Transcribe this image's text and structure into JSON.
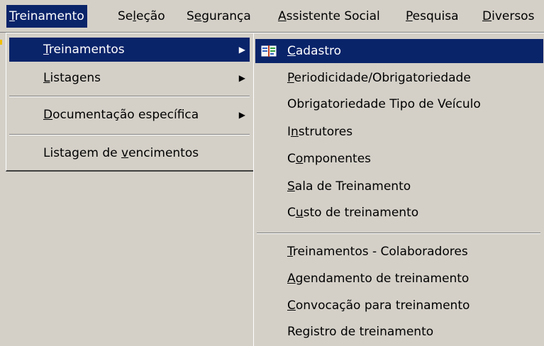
{
  "menubar": {
    "items": [
      {
        "id": "treinamento",
        "pre": "",
        "key": "T",
        "post": "reinamento",
        "active": true
      },
      {
        "id": "selecao",
        "pre": "Se",
        "key": "l",
        "post": "eção",
        "active": false
      },
      {
        "id": "seguranca",
        "pre": "S",
        "key": "e",
        "post": "gurança",
        "active": false
      },
      {
        "id": "assistente-social",
        "pre": "",
        "key": "A",
        "post": "ssistente Social",
        "active": false
      },
      {
        "id": "pesquisa",
        "pre": "",
        "key": "P",
        "post": "esquisa",
        "active": false
      },
      {
        "id": "diversos",
        "pre": "",
        "key": "D",
        "post": "iversos",
        "active": false
      }
    ]
  },
  "dropdown": {
    "items": [
      {
        "id": "treinamentos",
        "pre": "",
        "key": "T",
        "post": "reinamentos",
        "arrow": "▶",
        "selected": true
      },
      {
        "id": "listagens",
        "pre": "",
        "key": "L",
        "post": "istagens",
        "arrow": "▶",
        "selected": false
      },
      {
        "id": "documentacao-especifica",
        "pre": "",
        "key": "D",
        "post": "ocumentação específica",
        "arrow": "▶",
        "selected": false
      },
      {
        "id": "listagem-de-vencimentos",
        "pre": "Listagem de ",
        "key": "v",
        "post": "encimentos",
        "arrow": "",
        "selected": false
      }
    ]
  },
  "submenu": {
    "items": [
      {
        "id": "cadastro",
        "pre": "",
        "key": "C",
        "post": "adastro",
        "icon": "book-icon",
        "selected": true
      },
      {
        "id": "periodicidade",
        "pre": "",
        "key": "P",
        "post": "eriodicidade/Obrigatoriedade",
        "selected": false
      },
      {
        "id": "obrigatoriedade-tipo-veiculo",
        "pre": "Obrigatoriedade Tipo de Veículo",
        "key": "",
        "post": "",
        "selected": false
      },
      {
        "id": "instrutores",
        "pre": "I",
        "key": "n",
        "post": "strutores",
        "selected": false
      },
      {
        "id": "componentes",
        "pre": "C",
        "key": "o",
        "post": "mponentes",
        "selected": false
      },
      {
        "id": "sala-de-treinamento",
        "pre": "",
        "key": "S",
        "post": "ala de Treinamento",
        "selected": false
      },
      {
        "id": "custo-de-treinamento",
        "pre": "C",
        "key": "u",
        "post": "sto de treinamento",
        "selected": false
      },
      {
        "id": "treinamentos-colaboradores",
        "pre": "",
        "key": "T",
        "post": "reinamentos - Colaboradores",
        "selected": false
      },
      {
        "id": "agendamento-de-treinamento",
        "pre": "",
        "key": "A",
        "post": "gendamento de treinamento",
        "selected": false
      },
      {
        "id": "convocacao-para-treinamento",
        "pre": "",
        "key": "C",
        "post": "onvocação para treinamento",
        "selected": false
      },
      {
        "id": "registro-de-treinamento",
        "pre": "Registro de treinamento",
        "key": "",
        "post": "",
        "selected": false
      }
    ]
  },
  "colors": {
    "menu_bg": "#d4d0c8",
    "highlight_bg": "#0a246a",
    "highlight_fg": "#ffffff",
    "text": "#000000"
  }
}
